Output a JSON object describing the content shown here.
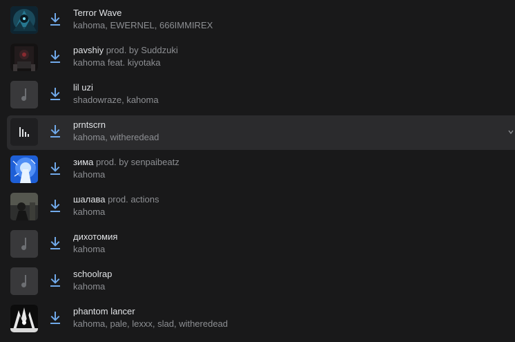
{
  "tracks": [
    {
      "title": "Terror Wave",
      "subtitle": "",
      "artists": "kahoma, EWERNEL, 666IMMIREX",
      "cover": "art-blue-dark",
      "active": false
    },
    {
      "title": "pavshiy",
      "subtitle": " prod. by Suddzuki",
      "artists": "kahoma feat. kiyotaka",
      "cover": "art-dark-red",
      "active": false
    },
    {
      "title": "lil uzi",
      "subtitle": "",
      "artists": "shadowraze, kahoma",
      "cover": "music-note-icon",
      "active": false
    },
    {
      "title": "prntscrn",
      "subtitle": "",
      "artists": "kahoma, witheredead",
      "cover": "equalizer-icon",
      "active": true
    },
    {
      "title": "зима",
      "subtitle": " prod. by senpaibeatz",
      "artists": "kahoma",
      "cover": "art-blue-bright",
      "active": false
    },
    {
      "title": "шалава",
      "subtitle": " prod. actions",
      "artists": "kahoma",
      "cover": "art-grey-photo",
      "active": false
    },
    {
      "title": "дихотомия",
      "subtitle": "",
      "artists": "kahoma",
      "cover": "music-note-icon",
      "active": false
    },
    {
      "title": "schoolrap",
      "subtitle": "",
      "artists": "kahoma",
      "cover": "music-note-icon",
      "active": false
    },
    {
      "title": "phantom lancer",
      "subtitle": "",
      "artists": "kahoma, pale, lexxx, slad, witheredead",
      "cover": "art-black-white",
      "active": false
    }
  ],
  "colors": {
    "background": "#19191a",
    "active_row": "#2b2b2d",
    "download_icon": "#71aaeb",
    "placeholder_cover": "#39393b",
    "placeholder_glyph": "#6d6f73",
    "title": "#e1e3e6",
    "secondary": "#8d8f93"
  },
  "icons": {
    "download": "download-icon",
    "placeholder": "music-note-icon",
    "playing": "equalizer-icon"
  }
}
